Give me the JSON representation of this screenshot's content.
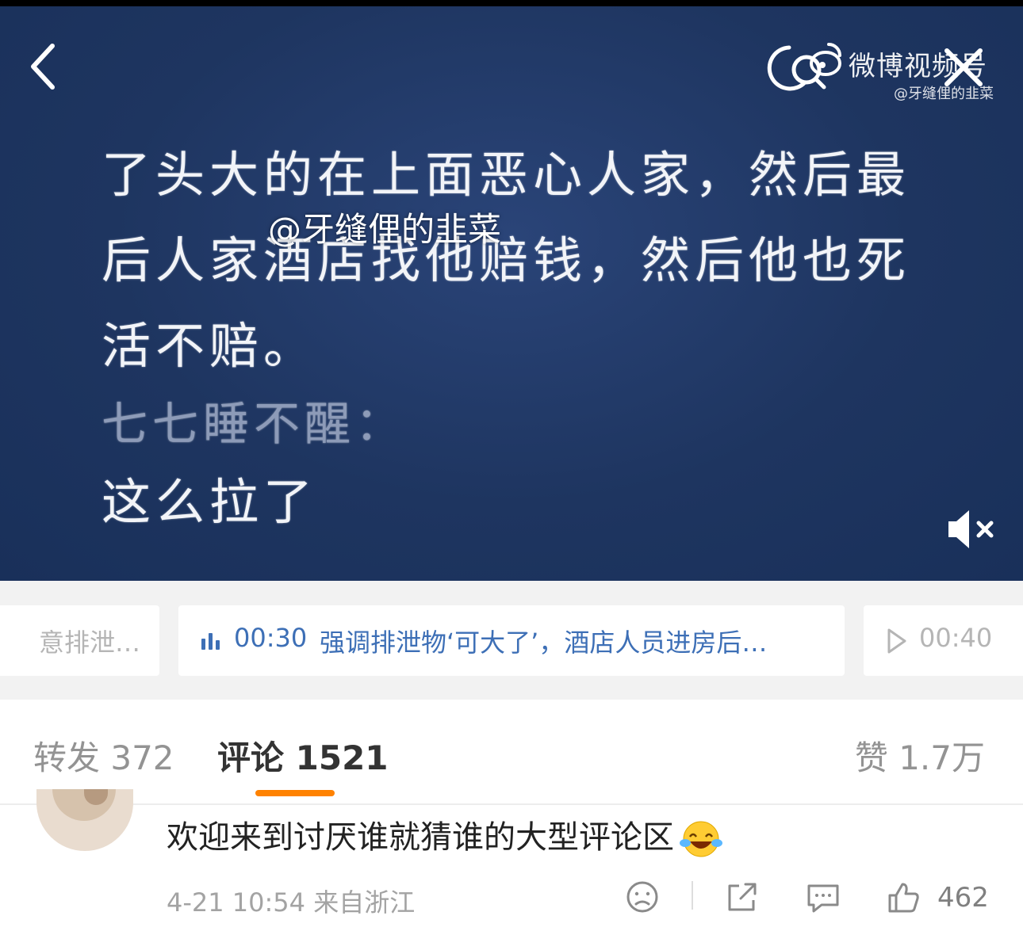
{
  "video": {
    "watermark_title": "微博视频号",
    "watermark_user": "@牙缝俚的韭菜",
    "overlay_watermark": "@牙缝俚的韭菜",
    "subtitles": [
      "了头大的在上面恶心人家，然后最",
      "后人家酒店找他赔钱，然后他也死",
      "活不赔。",
      "七七睡不醒：",
      "这么拉了"
    ],
    "icons": {
      "back": "chevron-left-icon",
      "close": "close-icon",
      "mute": "volume-muted-icon"
    }
  },
  "chapters": [
    {
      "label": "意排泄…",
      "state": "previous"
    },
    {
      "time": "00:30",
      "label": "强调排泄物‘可大了’，酒店人员进房后…",
      "state": "active"
    },
    {
      "time": "00:40",
      "state": "next"
    }
  ],
  "tabs": {
    "repost": "转发 372",
    "comment": "评论 1521",
    "like": "赞 1.7万"
  },
  "comment": {
    "text": "欢迎来到讨厌谁就猜谁的大型评论区",
    "emoji": "laughing-tears-emoji",
    "meta": "4-21 10:54  来自浙江",
    "likes": "462"
  },
  "colors": {
    "accent": "#ff8200",
    "chapter_active": "#3d6fb6",
    "video_bg": "#1e3560"
  }
}
